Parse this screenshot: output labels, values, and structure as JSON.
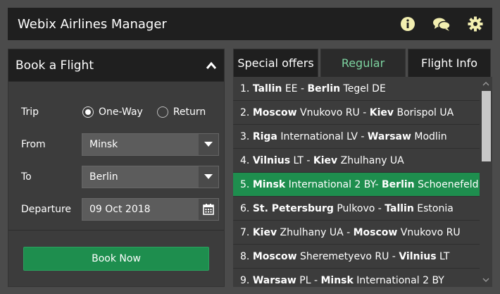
{
  "app": {
    "title": "Webix Airlines Manager"
  },
  "toolbar": {
    "icons": [
      "info-icon",
      "chat-icon",
      "gear-icon"
    ]
  },
  "booking": {
    "panel_title": "Book a Flight",
    "trip_label": "Trip",
    "trip_options": [
      "One-Way",
      "Return"
    ],
    "trip_selected": "One-Way",
    "from_label": "From",
    "from_value": "Minsk",
    "to_label": "To",
    "to_value": "Berlin",
    "departure_label": "Departure",
    "departure_value": "09 Oct 2018",
    "book_button": "Book Now"
  },
  "tabs": [
    {
      "label": "Special offers",
      "active": false
    },
    {
      "label": "Regular",
      "active": true
    },
    {
      "label": "Flight Info",
      "active": false
    }
  ],
  "flights": [
    {
      "num": "1.",
      "from_city": "Tallin",
      "from_rest": " EE - ",
      "to_city": "Berlin",
      "to_rest": " Tegel DE",
      "selected": false
    },
    {
      "num": "2.",
      "from_city": "Moscow",
      "from_rest": " Vnukovo RU - ",
      "to_city": "Kiev",
      "to_rest": " Borispol UA",
      "selected": false
    },
    {
      "num": "3.",
      "from_city": "Riga",
      "from_rest": " International LV - ",
      "to_city": "Warsaw",
      "to_rest": " Modlin",
      "selected": false
    },
    {
      "num": "4.",
      "from_city": "Vilnius",
      "from_rest": " LT - ",
      "to_city": "Kiev",
      "to_rest": " Zhulhany UA",
      "selected": false
    },
    {
      "num": "5.",
      "from_city": "Minsk",
      "from_rest": " International 2 BY- ",
      "to_city": "Berlin",
      "to_rest": " Schoenefeld DE",
      "selected": true
    },
    {
      "num": "6.",
      "from_city": "St. Petersburg",
      "from_rest": " Pulkovo - ",
      "to_city": "Tallin",
      "to_rest": " Estonia",
      "selected": false
    },
    {
      "num": "7.",
      "from_city": "Kiev",
      "from_rest": " Zhulhany UA - ",
      "to_city": "Moscow",
      "to_rest": " Vnukovo RU",
      "selected": false
    },
    {
      "num": "8.",
      "from_city": "Moscow",
      "from_rest": " Sheremetyevo RU - ",
      "to_city": "Vilnius",
      "to_rest": " LT",
      "selected": false
    },
    {
      "num": "9.",
      "from_city": "Warsaw",
      "from_rest": " PL - ",
      "to_city": "Minsk",
      "to_rest": " International 2 BY",
      "selected": false
    }
  ],
  "colors": {
    "accent": "#1e8e4e",
    "active_tab_text": "#7dd3a0",
    "toolbar_bg": "#1f1f1f"
  }
}
